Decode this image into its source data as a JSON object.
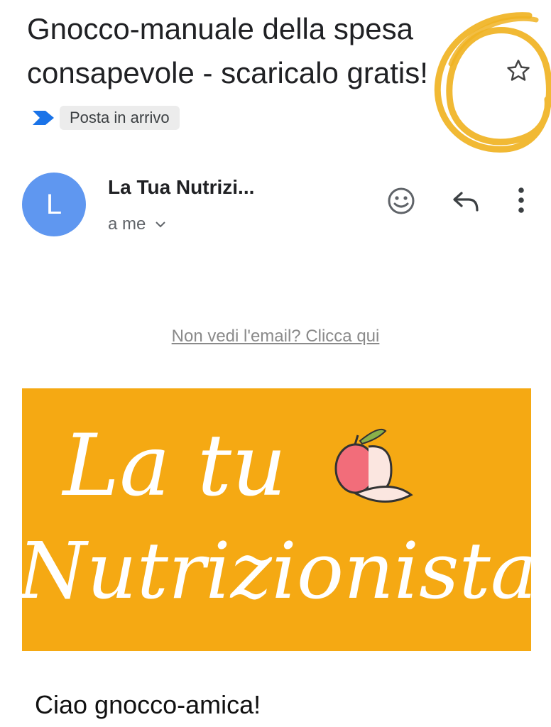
{
  "email": {
    "subject": "Gnocco-manuale della spesa consapevole - scaricalo gratis!",
    "label": "Posta in arrivo",
    "sender_initial": "L",
    "sender_name": "La Tua Nutrizi...",
    "recipient": "a me",
    "view_online_link": "Non vedi l'email? Clicca qui",
    "banner": {
      "logo_text": "La tua Nutrizionista",
      "background": "#f5a913"
    },
    "greeting": "Ciao gnocco-amica!"
  },
  "icons": {
    "star": "star-icon",
    "importance": "importance-marker-icon",
    "emoji": "emoji-reaction-icon",
    "reply": "reply-icon",
    "more": "more-vert-icon",
    "chevron": "chevron-down-icon"
  },
  "colors": {
    "avatar": "#5f97f0",
    "importance_marker": "#1a73e8",
    "annotation_scribble": "#f0b323",
    "link": "#8a8a8a"
  }
}
